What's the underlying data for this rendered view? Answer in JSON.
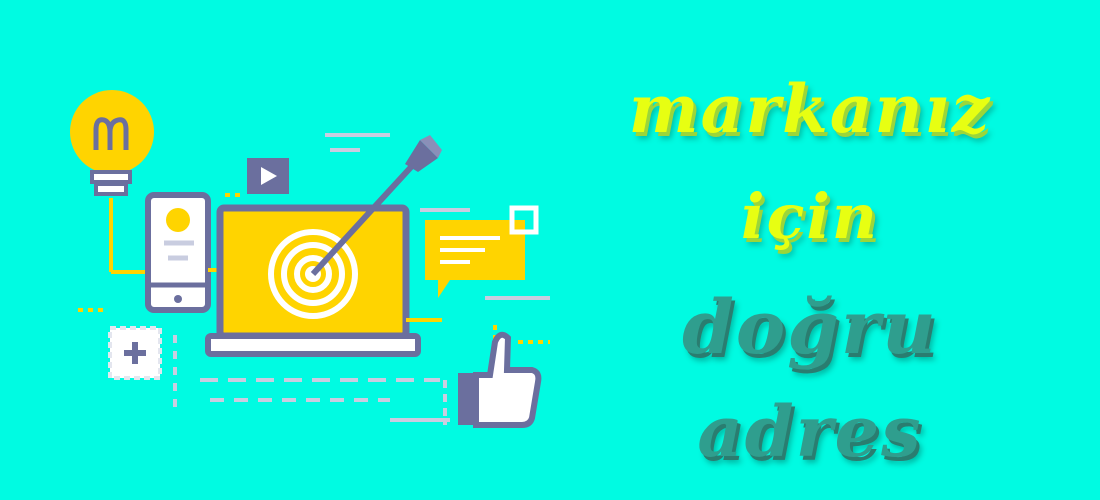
{
  "banner": {
    "slogan": {
      "line1": "markanız",
      "line2": "için",
      "line3": "doğru",
      "line4": "adres"
    },
    "icons": [
      "lightbulb-icon",
      "smartphone-icon",
      "laptop-icon",
      "target-icon",
      "arrow-icon",
      "play-icon",
      "chat-bubble-icon",
      "thumbs-up-icon",
      "plus-icon"
    ],
    "colors": {
      "background": "#00fbe2",
      "accent_yellow": "#ffd400",
      "outline": "#6b6f9e",
      "text_light": "#e7ff12",
      "text_dark": "#2f9e8e"
    }
  }
}
